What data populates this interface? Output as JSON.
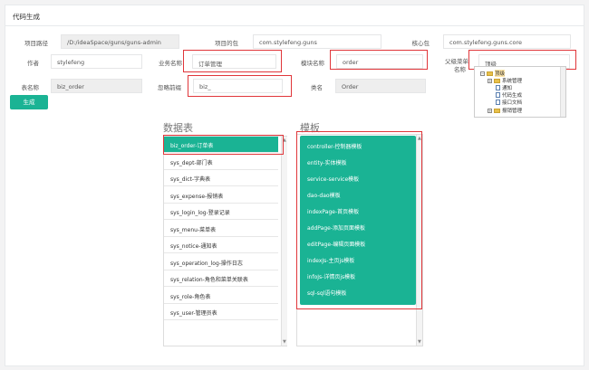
{
  "panel": {
    "title": "代码生成"
  },
  "form": {
    "project_path": {
      "label": "项目路径",
      "value": "/D:/ideaSpace/guns/guns-admin"
    },
    "project_package": {
      "label": "项目的包",
      "value": "com.stylefeng.guns"
    },
    "core_package": {
      "label": "核心包",
      "value": "com.stylefeng.guns.core"
    },
    "author": {
      "label": "作者",
      "value": "stylefeng"
    },
    "business_name": {
      "label": "业务名称",
      "value": "订单管理"
    },
    "module_name": {
      "label": "模块名称",
      "value": "order"
    },
    "parent_menu": {
      "label_line1": "父级菜单",
      "label_line2": "名称",
      "value": "顶级"
    },
    "table_name": {
      "label": "表名称",
      "value": "biz_order"
    },
    "ignore_prefix": {
      "label": "忽略前缀",
      "value": "biz_"
    },
    "class_name": {
      "label": "类名",
      "value": "Order"
    }
  },
  "generate_button": "生成",
  "menu_tree": [
    {
      "label": "顶级"
    },
    {
      "label": "系统管理"
    },
    {
      "label": "通知"
    },
    {
      "label": "代码生成"
    },
    {
      "label": "接口文档"
    },
    {
      "label": "报销管理"
    }
  ],
  "tables_section": {
    "title": "数据表",
    "items": [
      "biz_order-订单表",
      "sys_dept-部门表",
      "sys_dict-字典表",
      "sys_expense-报销表",
      "sys_login_log-登录记录",
      "sys_menu-菜单表",
      "sys_notice-通知表",
      "sys_operation_log-操作日志",
      "sys_relation-角色和菜单关联表",
      "sys_role-角色表",
      "sys_user-管理员表"
    ]
  },
  "templates_section": {
    "title": "模板",
    "items": [
      "controller-控制器模板",
      "entity-实体模板",
      "service-service模板",
      "dao-dao模板",
      "indexPage-首页模板",
      "addPage-添加页面模板",
      "editPage-编辑页面模板",
      "indexJs-主页js模板",
      "infoJs-详情页js模板",
      "sql-sql语句模板"
    ]
  },
  "colors": {
    "accent": "#1ab394",
    "highlight_border": "#e0363a"
  }
}
